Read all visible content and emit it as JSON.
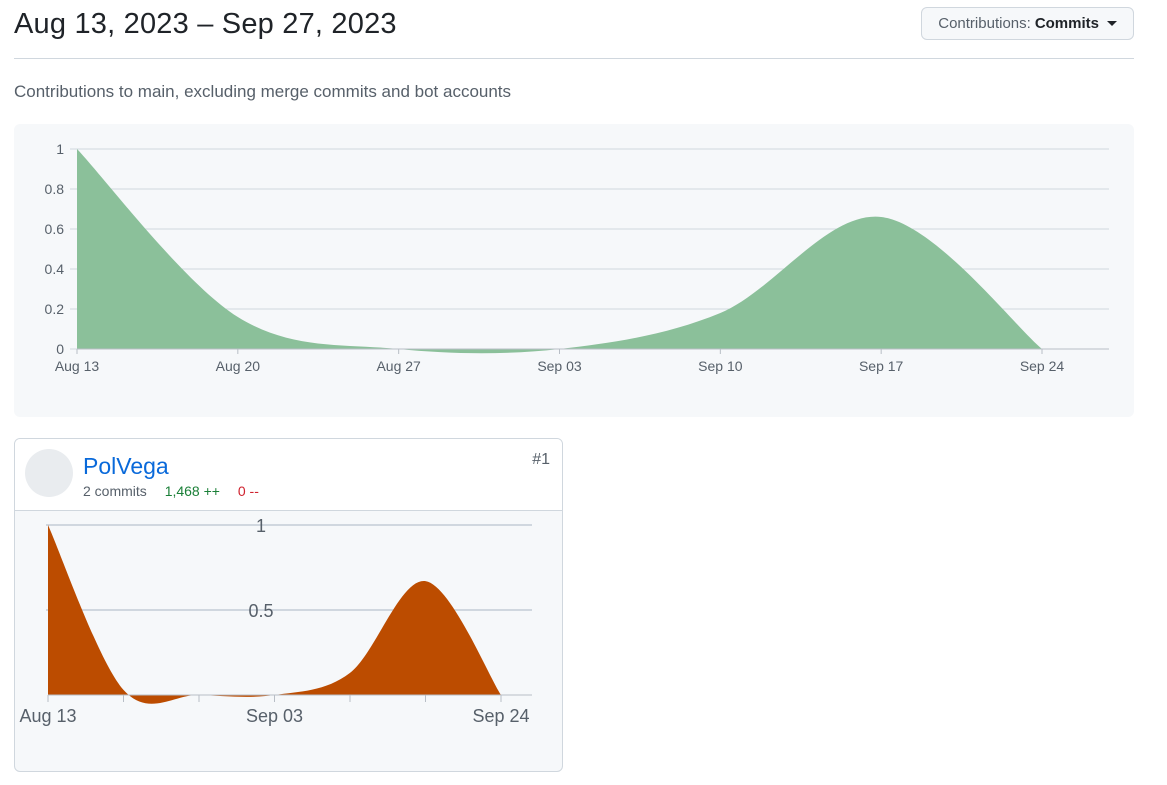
{
  "header": {
    "title": "Aug 13, 2023 – Sep 27, 2023",
    "contrib_label": "Contributions:",
    "contrib_value": "Commits",
    "caret_icon": "caret-down-icon"
  },
  "subtitle": "Contributions to main, excluding merge commits and bot accounts",
  "colors": {
    "main_area": "#8bc09a",
    "user_area": "#bc4c00",
    "link": "#0969da"
  },
  "chart_data": [
    {
      "type": "area",
      "x": [
        "Aug 13",
        "Aug 20",
        "Aug 27",
        "Sep 03",
        "Sep 10",
        "Sep 17",
        "Sep 24"
      ],
      "values": [
        1,
        0.16,
        0,
        0,
        0.18,
        0.66,
        0
      ],
      "xlabel": "",
      "ylabel": "",
      "ylim": [
        0,
        1
      ],
      "yticks": [
        "0",
        "0.2",
        "0.4",
        "0.6",
        "0.8",
        "1"
      ],
      "grid": true
    },
    {
      "type": "area",
      "x": [
        "Aug 13",
        "",
        "",
        "Sep 03",
        "",
        "",
        "Sep 24"
      ],
      "values": [
        1,
        0.03,
        0,
        0,
        0.13,
        0.67,
        0
      ],
      "xlabel": "",
      "ylabel": "",
      "ylim": [
        0,
        1
      ],
      "yticks": [
        "0.5",
        "1"
      ],
      "grid": true
    }
  ],
  "contributor": {
    "name": "PolVega",
    "commits": "2 commits",
    "additions": "1,468 ++",
    "deletions": "0 --",
    "rank": "#1",
    "avatar_icon": "user-avatar-icon"
  }
}
